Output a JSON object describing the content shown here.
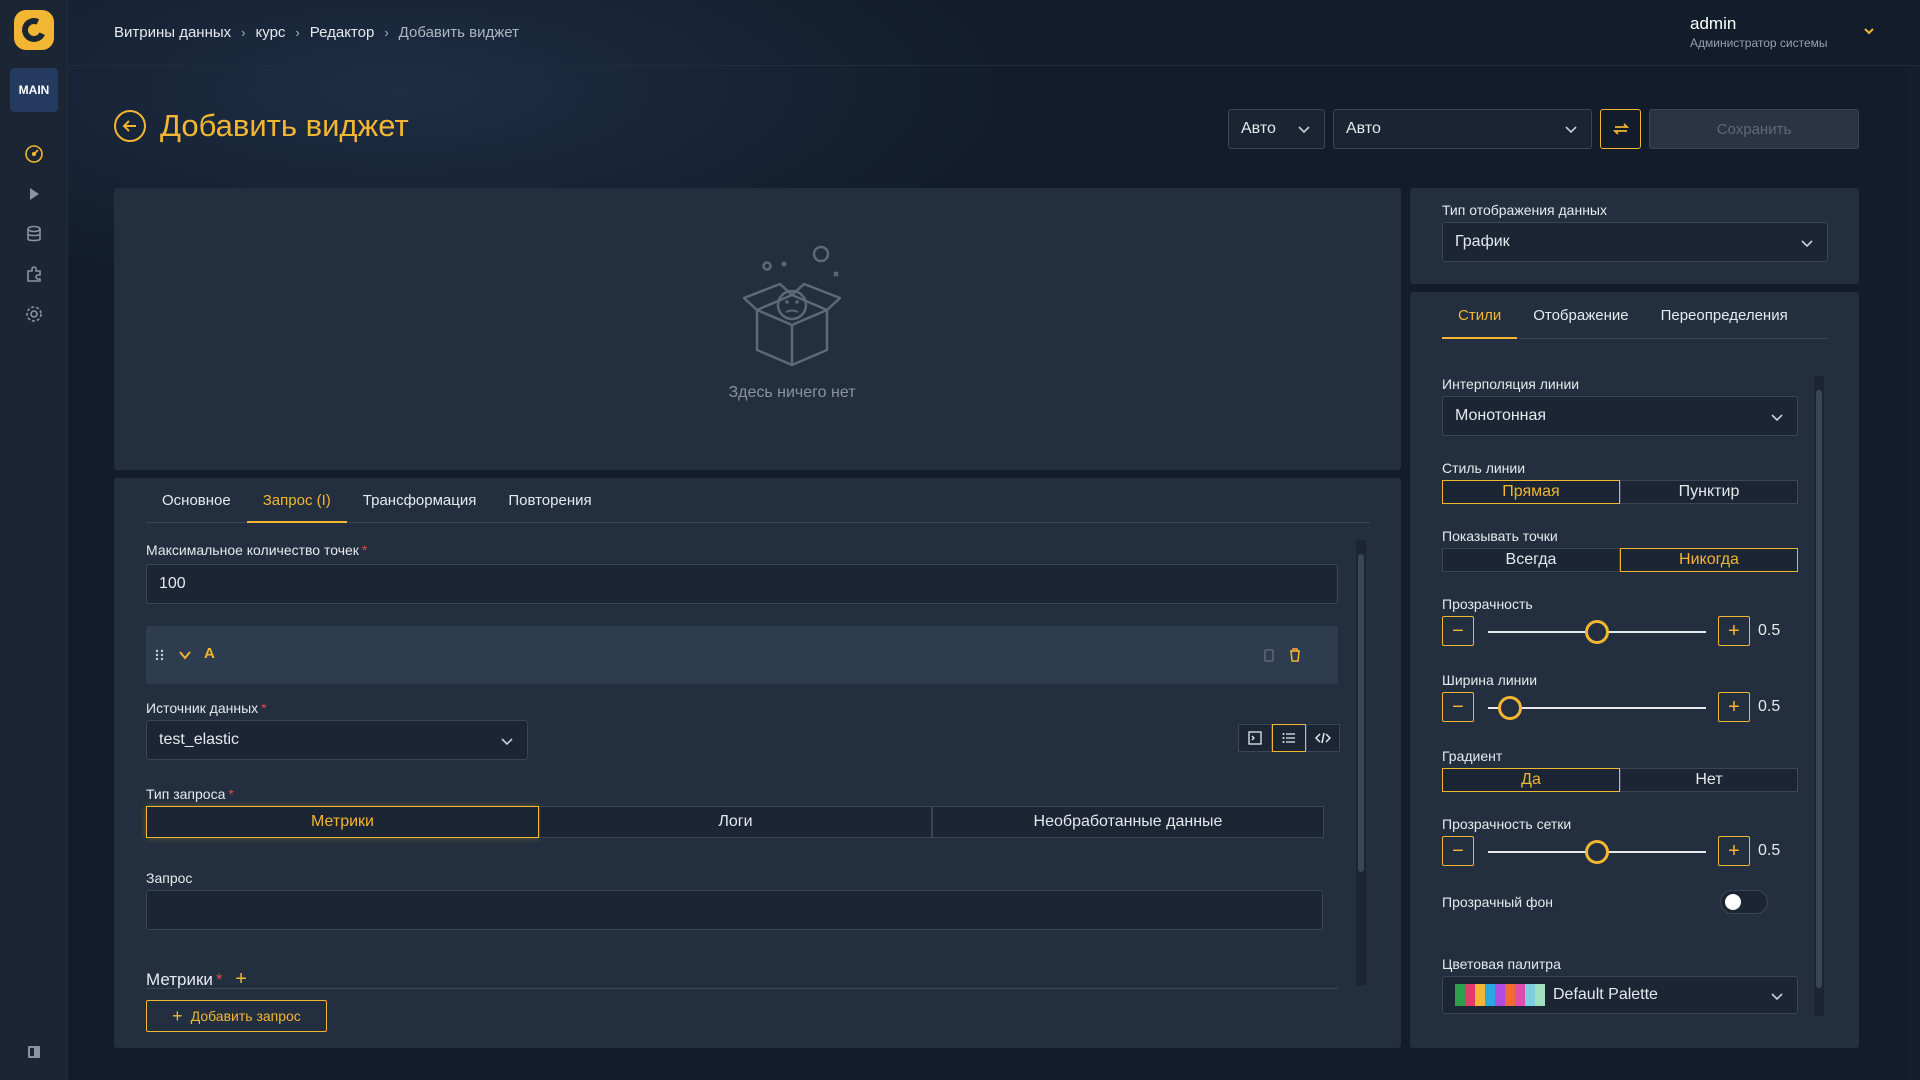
{
  "sidebar": {
    "badge": "MAIN",
    "icons": [
      "dashboard-icon",
      "play-icon",
      "database-icon",
      "puzzle-icon",
      "gear-icon"
    ],
    "bottom_icon": "panel-toggle-icon"
  },
  "header": {
    "breadcrumb": [
      "Витрины данных",
      "курс",
      "Редактор",
      "Добавить виджет"
    ],
    "user_name": "admin",
    "user_role": "Администратор системы"
  },
  "title": "Добавить виджет",
  "toolbar": {
    "select1": "Авто",
    "select2": "Авто",
    "save_label": "Сохранить"
  },
  "preview": {
    "empty_text": "Здесь ничего нет"
  },
  "editor": {
    "tabs": [
      "Основное",
      "Запрос (I)",
      "Трансформация",
      "Повторения"
    ],
    "active_tab": 1,
    "max_points_label": "Максимальное количество точек",
    "max_points_value": "100",
    "query_letter": "A",
    "source_label": "Источник данных",
    "source_value": "test_elastic",
    "query_type_label": "Тип запроса",
    "query_types": [
      "Метрики",
      "Логи",
      "Необработанные данные"
    ],
    "query_type_selected": 0,
    "query_label": "Запрос",
    "query_value": "",
    "metrics_label": "Метрики",
    "add_query_label": "Добавить запрос"
  },
  "display_type": {
    "label": "Тип отображения данных",
    "value": "График"
  },
  "styles": {
    "tabs": [
      "Стили",
      "Отображение",
      "Переопределения"
    ],
    "active_tab": 0,
    "interp_label": "Интерполяция линии",
    "interp_value": "Монотонная",
    "line_style_label": "Стиль линии",
    "line_style_options": [
      "Прямая",
      "Пунктир"
    ],
    "line_style_selected": 0,
    "points_label": "Показывать точки",
    "points_options": [
      "Всегда",
      "Никогда"
    ],
    "points_selected": 1,
    "opacity_label": "Прозрачность",
    "opacity_value": "0.5",
    "opacity_fraction": 0.5,
    "width_label": "Ширина линии",
    "width_value": "0.5",
    "width_fraction": 0.1,
    "gradient_label": "Градиент",
    "gradient_options": [
      "Да",
      "Нет"
    ],
    "gradient_selected": 0,
    "grid_opacity_label": "Прозрачность сетки",
    "grid_opacity_value": "0.5",
    "grid_opacity_fraction": 0.5,
    "transparent_bg_label": "Прозрачный фон",
    "transparent_bg_on": false,
    "palette_label": "Цветовая палитра",
    "palette_value": "Default Palette",
    "palette_colors": [
      "#2e9e4e",
      "#e03c6b",
      "#f2b632",
      "#2aa7e0",
      "#b04be0",
      "#f26b32",
      "#e04bb0",
      "#7ad0e0",
      "#9fe0c0"
    ]
  },
  "colors": {
    "accent": "#f2b632",
    "bg": "#121c2a",
    "panel": "#232f3e"
  }
}
